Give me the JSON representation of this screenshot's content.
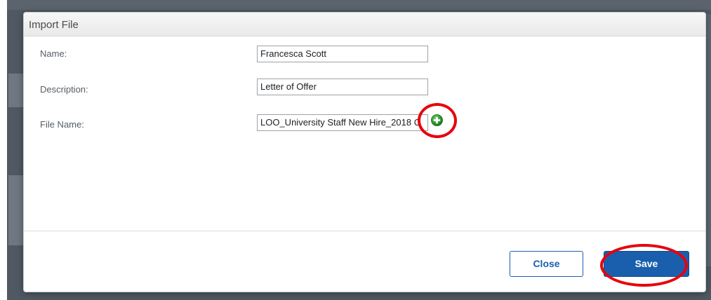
{
  "dialog": {
    "title": "Import File",
    "fields": {
      "name": {
        "label": "Name:",
        "value": "Francesca Scott"
      },
      "description": {
        "label": "Description:",
        "value": "Letter of Offer"
      },
      "file_name": {
        "label": "File Name:",
        "value": "LOO_University Staff New Hire_2018 C"
      }
    },
    "buttons": {
      "close_label": "Close",
      "save_label": "Save"
    }
  },
  "icons": {
    "add_file": "plus-circle-icon"
  },
  "colors": {
    "primary_button": "#1a5fae",
    "annotation": "#e8000b",
    "add_icon": "#2e9a2e"
  }
}
